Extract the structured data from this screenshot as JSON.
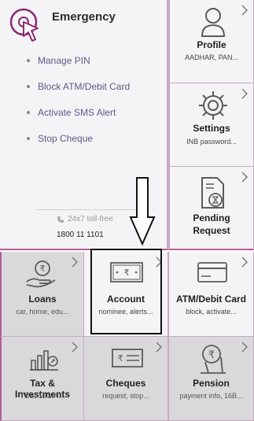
{
  "emergency": {
    "title": "Emergency",
    "items": [
      "Manage PIN",
      "Block ATM/Debit Card",
      "Activate SMS Alert",
      "Stop Cheque"
    ],
    "tollfree_label": "24x7 toll-free",
    "phone": "1800 11 1101"
  },
  "side_tiles": [
    {
      "title": "Profile",
      "subtitle": "AADHAR, PAN...",
      "icon": "person-icon"
    },
    {
      "title": "Settings",
      "subtitle": "INB password...",
      "icon": "gear-icon"
    },
    {
      "title": "Pending Request",
      "title_line1": "Pending",
      "title_line2": "Request",
      "subtitle": "",
      "icon": "pending-document-icon"
    }
  ],
  "grid_tiles": [
    {
      "title": "Loans",
      "subtitle": "car, home, edu...",
      "icon": "rupee-hand-icon"
    },
    {
      "title": "Account",
      "subtitle": "nominee, alerts...",
      "icon": "rupee-banknote-icon"
    },
    {
      "title": "ATM/Debit Card",
      "subtitle": "block, activate...",
      "icon": "card-icon"
    },
    {
      "title": "Tax & Investments",
      "subtitle": "TDS, 15G/H...",
      "icon": "bar-chart-icon"
    },
    {
      "title": "Cheques",
      "subtitle": "request, stop...",
      "icon": "cheque-icon"
    },
    {
      "title": "Pension",
      "subtitle": "payment info, 16B...",
      "icon": "pension-icon"
    }
  ],
  "colors": {
    "accent": "#8a2a74",
    "tile_bg": "#f4f4f6",
    "tile_bg_dark": "#d9d9dc",
    "icon_stroke": "#5b5b5b"
  }
}
